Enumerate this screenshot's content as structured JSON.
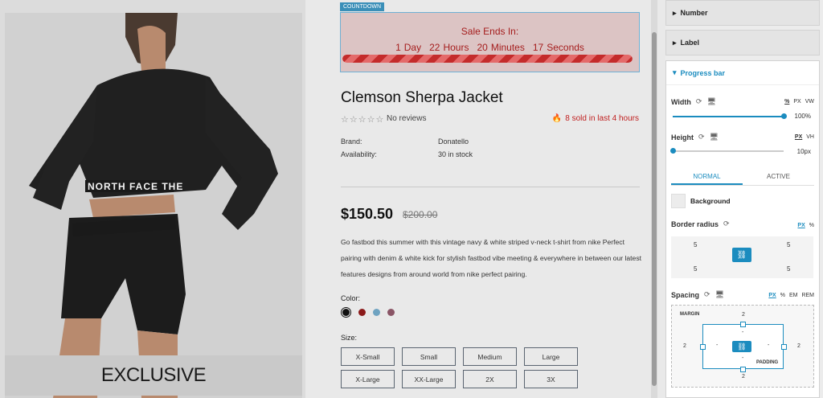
{
  "product_image": {
    "badge": "EXCLUSIVE",
    "brand_text": "NORTH FACE THE"
  },
  "countdown": {
    "tag": "COUNTDOWN",
    "title": "Sale Ends In:",
    "units": [
      {
        "value": "1",
        "label": "Day"
      },
      {
        "value": "22",
        "label": "Hours"
      },
      {
        "value": "20",
        "label": "Minutes"
      },
      {
        "value": "17",
        "label": "Seconds"
      }
    ],
    "progress_percent": 100
  },
  "product": {
    "title": "Clemson Sherpa Jacket",
    "reviews": "No reviews",
    "sold": "8 sold in last 4 hours",
    "meta": [
      {
        "key": "Brand:",
        "value": "Donatello"
      },
      {
        "key": "Availability:",
        "value": "30 in stock"
      }
    ],
    "price": "$150.50",
    "old_price": "$200.00",
    "description": "Go fastbod this summer with this vintage navy & white striped v-neck t-shirt from nike Perfect pairing with denim & white kick for stylish fastbod vibe meeting & everywhere in between our latest features designs from around world from nike perfect pairing.",
    "color_label": "Color:",
    "colors": [
      "#111111",
      "#8b1a1a",
      "#6fa3c1",
      "#8a5566"
    ],
    "size_label": "Size:",
    "sizes": [
      "X-Small",
      "Small",
      "Medium",
      "Large",
      "X-Large",
      "XX-Large",
      "2X",
      "3X"
    ]
  },
  "panel": {
    "sections_collapsed": [
      "Number",
      "Label"
    ],
    "open_section": "Progress bar",
    "width": {
      "label": "Width",
      "units": [
        "%",
        "PX",
        "VW"
      ],
      "active_unit": "%",
      "value": "100%",
      "fraction": 1.0
    },
    "height": {
      "label": "Height",
      "units": [
        "PX",
        "VH"
      ],
      "active_unit": "PX",
      "value": "10px",
      "fraction": 0.0
    },
    "tabs": [
      "NORMAL",
      "ACTIVE"
    ],
    "active_tab": "NORMAL",
    "background_label": "Background",
    "border_radius": {
      "label": "Border radius",
      "units": [
        "PX",
        "%"
      ],
      "values": [
        "5",
        "5",
        "5",
        "5"
      ]
    },
    "spacing": {
      "label": "Spacing",
      "units": [
        "PX",
        "%",
        "EM",
        "REM"
      ],
      "margin_label": "MARGIN",
      "padding_label": "PADDING",
      "margin": {
        "top": "2",
        "right": "2",
        "bottom": "2",
        "left": "2"
      },
      "padding": {
        "top": "-",
        "right": "-",
        "bottom": "-",
        "left": "-"
      }
    }
  }
}
